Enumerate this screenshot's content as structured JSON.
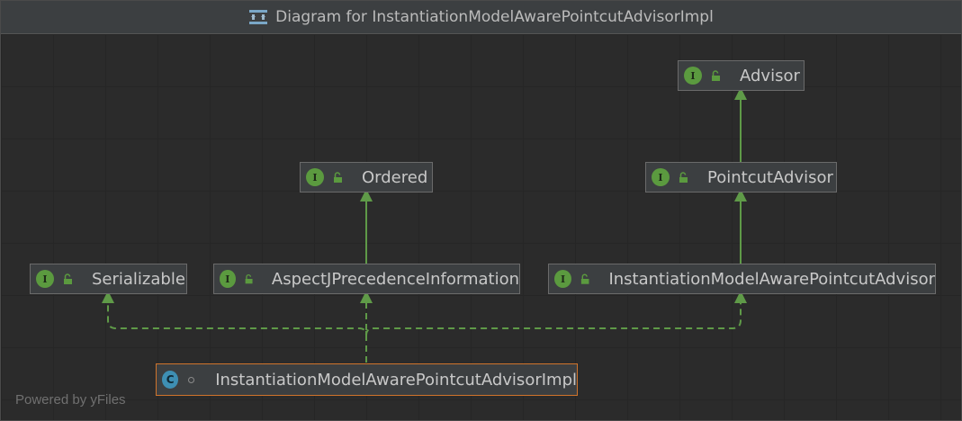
{
  "window": {
    "title": "Diagram for InstantiationModelAwarePointcutAdvisorImpl"
  },
  "nodes": {
    "advisor": {
      "label": "Advisor",
      "kind": "interface",
      "badge": "I"
    },
    "pointcut_advisor": {
      "label": "PointcutAdvisor",
      "kind": "interface",
      "badge": "I"
    },
    "ordered": {
      "label": "Ordered",
      "kind": "interface",
      "badge": "I"
    },
    "serializable": {
      "label": "Serializable",
      "kind": "interface",
      "badge": "I"
    },
    "aspectj_precedence": {
      "label": "AspectJPrecedenceInformation",
      "kind": "interface",
      "badge": "I"
    },
    "imapa": {
      "label": "InstantiationModelAwarePointcutAdvisor",
      "kind": "interface",
      "badge": "I"
    },
    "impl": {
      "label": "InstantiationModelAwarePointcutAdvisorImpl",
      "kind": "class",
      "badge": "C"
    }
  },
  "edges": [
    {
      "from": "PointcutAdvisor",
      "to": "Advisor",
      "style": "extends-solid"
    },
    {
      "from": "InstantiationModelAwarePointcutAdvisor",
      "to": "PointcutAdvisor",
      "style": "extends-solid"
    },
    {
      "from": "AspectJPrecedenceInformation",
      "to": "Ordered",
      "style": "extends-solid"
    },
    {
      "from": "InstantiationModelAwarePointcutAdvisorImpl",
      "to": "Serializable",
      "style": "implements-dashed"
    },
    {
      "from": "InstantiationModelAwarePointcutAdvisorImpl",
      "to": "AspectJPrecedenceInformation",
      "style": "implements-dashed"
    },
    {
      "from": "InstantiationModelAwarePointcutAdvisorImpl",
      "to": "InstantiationModelAwarePointcutAdvisor",
      "style": "implements-dashed"
    }
  ],
  "colors": {
    "edge": "#5f9a48",
    "interface_badge": "#5b9a3f",
    "class_badge": "#3e8fb3",
    "selection": "#d0742c"
  },
  "footer": {
    "text": "Powered by yFiles"
  }
}
